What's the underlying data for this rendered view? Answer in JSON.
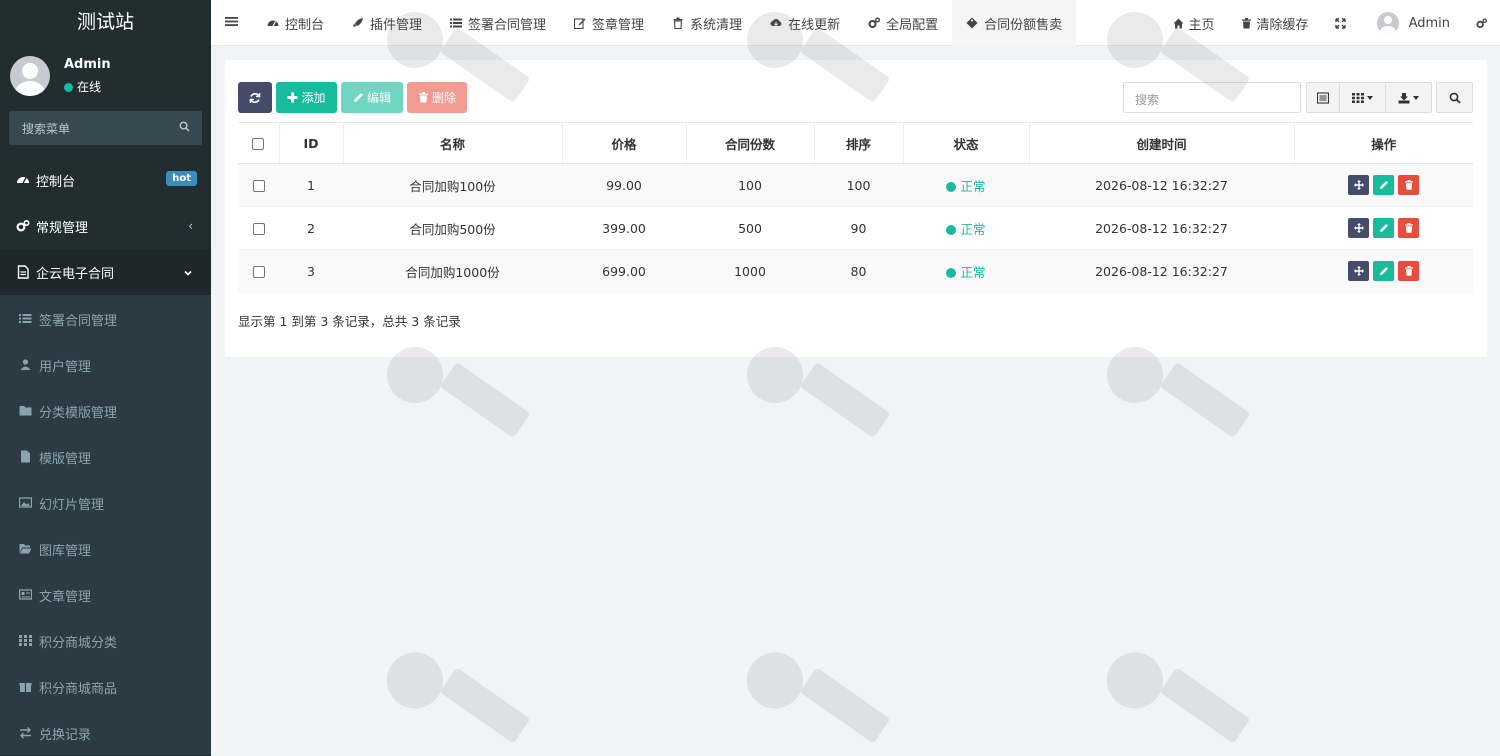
{
  "sidebar": {
    "site_title": "测试站",
    "user_name": "Admin",
    "user_status": "在线",
    "search_placeholder": "搜索菜单",
    "menu": [
      {
        "label": "控制台",
        "badge": "hot"
      },
      {
        "label": "常规管理"
      },
      {
        "label": "企云电子合同"
      }
    ],
    "submenu": [
      {
        "label": "签署合同管理"
      },
      {
        "label": "用户管理"
      },
      {
        "label": "分类模版管理"
      },
      {
        "label": "模版管理"
      },
      {
        "label": "幻灯片管理"
      },
      {
        "label": "图库管理"
      },
      {
        "label": "文章管理"
      },
      {
        "label": "积分商城分类"
      },
      {
        "label": "积分商城商品"
      },
      {
        "label": "兑换记录"
      }
    ]
  },
  "topbar": {
    "tabs": [
      {
        "label": "控制台"
      },
      {
        "label": "插件管理"
      },
      {
        "label": "签署合同管理"
      },
      {
        "label": "签章管理"
      },
      {
        "label": "系统清理"
      },
      {
        "label": "在线更新"
      },
      {
        "label": "全局配置"
      },
      {
        "label": "合同份额售卖"
      }
    ],
    "home_label": "主页",
    "clear_cache_label": "清除缓存",
    "admin_label": "Admin"
  },
  "toolbar": {
    "add_label": "添加",
    "edit_label": "编辑",
    "delete_label": "删除",
    "search_placeholder": "搜索"
  },
  "table": {
    "headers": [
      "ID",
      "名称",
      "价格",
      "合同份数",
      "排序",
      "状态",
      "创建时间",
      "操作"
    ],
    "rows": [
      {
        "id": "1",
        "name": "合同加购100份",
        "price": "99.00",
        "count": "100",
        "sort": "100",
        "status": "正常",
        "created": "2026-08-12 16:32:27"
      },
      {
        "id": "2",
        "name": "合同加购500份",
        "price": "399.00",
        "count": "500",
        "sort": "90",
        "status": "正常",
        "created": "2026-08-12 16:32:27"
      },
      {
        "id": "3",
        "name": "合同加购1000份",
        "price": "699.00",
        "count": "1000",
        "sort": "80",
        "status": "正常",
        "created": "2026-08-12 16:32:27"
      }
    ]
  },
  "pagination": {
    "summary": "显示第 1 到第 3 条记录，总共 3 条记录"
  },
  "colors": {
    "primary": "#18bc9c",
    "dark": "#444c69",
    "danger": "#e74c3c",
    "sidebar": "#222d32"
  }
}
